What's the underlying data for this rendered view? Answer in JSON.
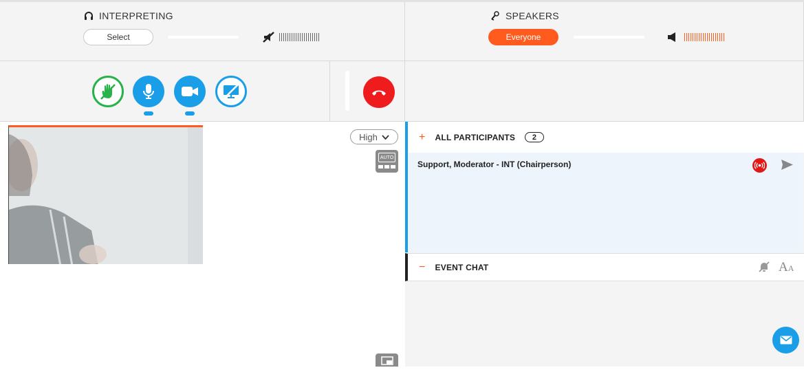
{
  "interpreting": {
    "title": "INTERPRETING",
    "select_label": "Select"
  },
  "speakers": {
    "title": "SPEAKERS",
    "audience_label": "Everyone"
  },
  "controls": {
    "icons": [
      "raise-hand-icon",
      "microphone-icon",
      "camera-icon",
      "screen-share-off-icon",
      "hang-up-icon"
    ]
  },
  "video": {
    "quality_label": "High",
    "auto_label": "AUTO"
  },
  "participants": {
    "section_toggle": "+",
    "section_title": "ALL PARTICIPANTS",
    "count": "2",
    "items": [
      {
        "name": "Support, Moderator - INT (Chairperson)"
      }
    ]
  },
  "event_chat": {
    "section_toggle": "−",
    "section_title": "EVENT CHAT",
    "font_label": "A"
  },
  "colors": {
    "accent_orange": "#ff5b1f",
    "accent_blue": "#1a9ee8",
    "raise_hand_green": "#27b24a",
    "hangup_red": "#ee1c1c"
  }
}
